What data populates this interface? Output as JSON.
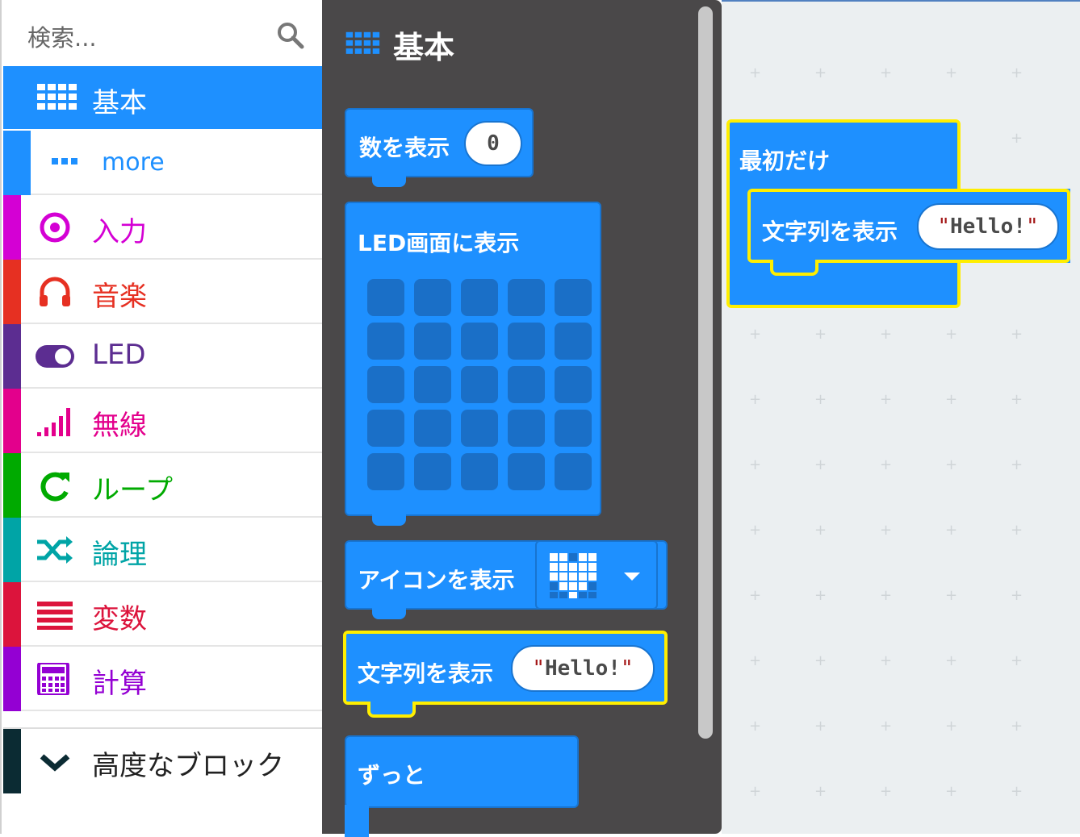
{
  "search": {
    "placeholder": "検索..."
  },
  "categories": [
    {
      "label": "基本",
      "icon": "grid-icon",
      "color": "#1e90ff"
    },
    {
      "label": "more",
      "icon": "dots-icon",
      "color": "#1e90ff"
    },
    {
      "label": "入力",
      "icon": "target-icon",
      "color": "#d400d4"
    },
    {
      "label": "音楽",
      "icon": "headphones-icon",
      "color": "#e63022"
    },
    {
      "label": "LED",
      "icon": "toggle-icon",
      "color": "#5c2d91"
    },
    {
      "label": "無線",
      "icon": "signal-icon",
      "color": "#e3008c"
    },
    {
      "label": "ループ",
      "icon": "loop-icon",
      "color": "#00aa00"
    },
    {
      "label": "論理",
      "icon": "shuffle-icon",
      "color": "#00a4a6"
    },
    {
      "label": "変数",
      "icon": "lines-icon",
      "color": "#dc143c"
    },
    {
      "label": "計算",
      "icon": "calculator-icon",
      "color": "#9400d3"
    }
  ],
  "advanced": {
    "label": "高度なブロック",
    "icon": "chevron-down-icon"
  },
  "flyout": {
    "title": "基本",
    "blocks": {
      "show_number": {
        "label": "数を表示",
        "value": "0"
      },
      "show_leds": {
        "label": "LED画面に表示"
      },
      "show_icon": {
        "label": "アイコンを表示"
      },
      "show_string": {
        "label": "文字列を表示",
        "value": "Hello!"
      },
      "forever": {
        "label": "ずっと"
      }
    }
  },
  "workspace": {
    "on_start": {
      "label": "最初だけ"
    },
    "show_string": {
      "label": "文字列を表示",
      "value": "Hello!"
    }
  },
  "quote": "\""
}
